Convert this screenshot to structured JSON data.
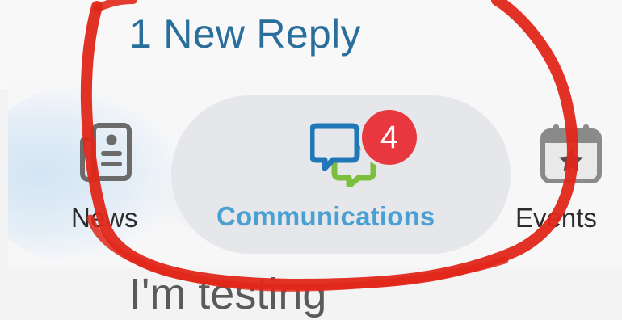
{
  "header": {
    "new_reply_text": "1 New Reply"
  },
  "tabs": [
    {
      "label": "News",
      "icon": "news-icon"
    },
    {
      "label": "Communications",
      "icon": "chat-bubbles-icon",
      "badge": "4",
      "active": true
    },
    {
      "label": "Events",
      "icon": "calendar-star-icon"
    }
  ],
  "message": {
    "preview_text": "I'm testing"
  },
  "colors": {
    "accent": "#4a9fd3",
    "link": "#2a6f9c",
    "badge": "#e8373f",
    "annotation": "#e0271a"
  }
}
